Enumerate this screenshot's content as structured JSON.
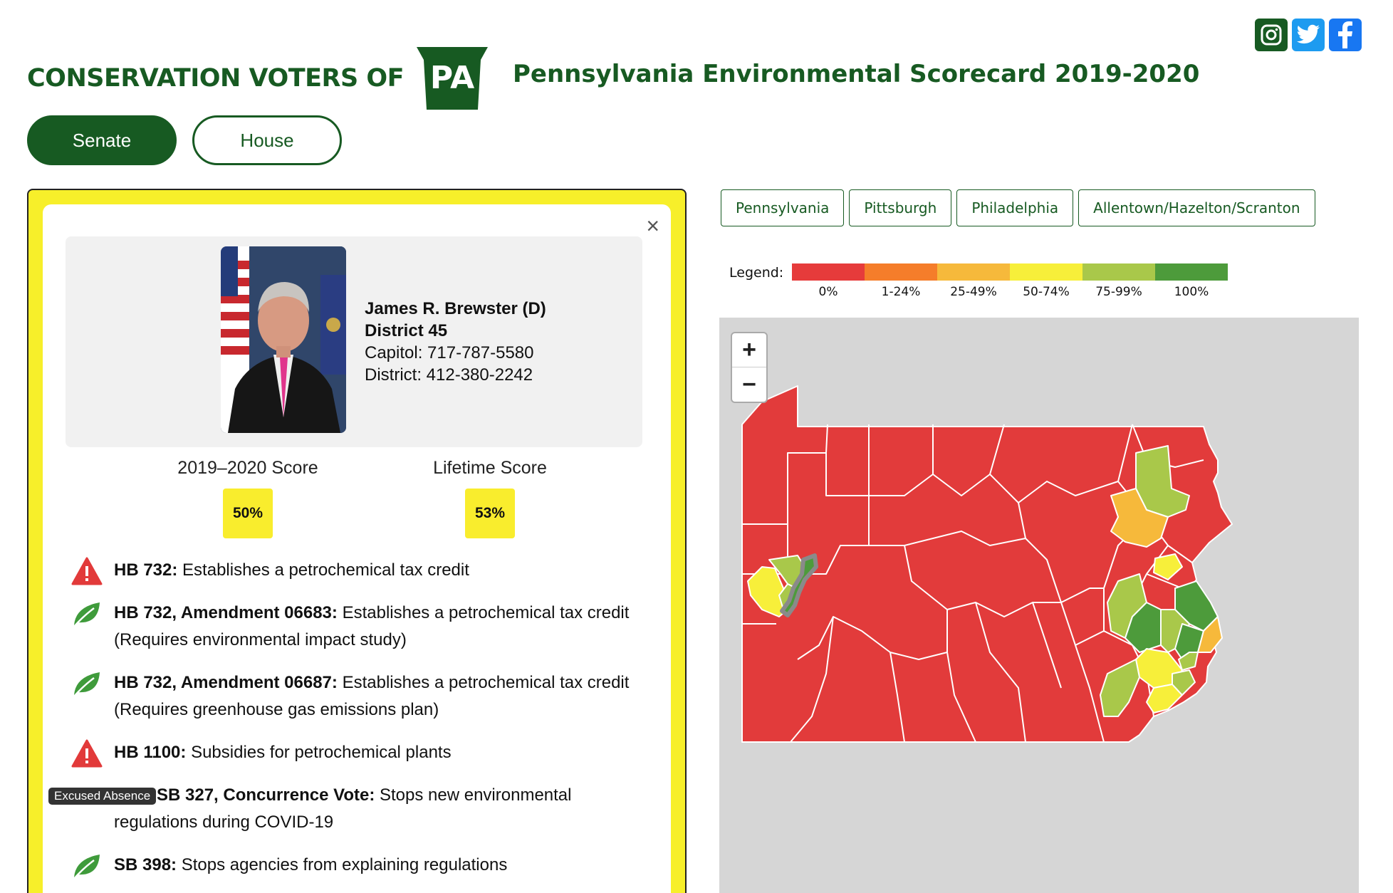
{
  "header": {
    "org_name": "CONSERVATION VOTERS OF",
    "logo_text": "PA",
    "title": "Pennsylvania Environmental Scorecard 2019-2020"
  },
  "social": [
    {
      "name": "instagram-icon",
      "color": "#175a22"
    },
    {
      "name": "twitter-icon",
      "color": "#1d9bf0"
    },
    {
      "name": "facebook-icon",
      "color": "#1877f2"
    }
  ],
  "chamber_tabs": {
    "senate": "Senate",
    "house": "House",
    "active": "Senate"
  },
  "legislator": {
    "name": "James R. Brewster (D)",
    "district": "District 45",
    "capitol_phone": "Capitol: 717-787-5580",
    "district_phone": "District: 412-380-2242",
    "close_label": "×"
  },
  "scores": {
    "current_label": "2019–2020 Score",
    "current_value": "50%",
    "lifetime_label": "Lifetime Score",
    "lifetime_value": "53%"
  },
  "votes": [
    {
      "icon": "warning-icon",
      "bill": "HB 732:",
      "desc": "Establishes a petrochemical tax credit"
    },
    {
      "icon": "leaf-icon",
      "bill": "HB 732, Amendment 06683:",
      "desc": "Establishes a petrochemical tax credit (Requires environmental impact study)"
    },
    {
      "icon": "leaf-icon",
      "bill": "HB 732, Amendment 06687:",
      "desc": "Establishes a petrochemical tax credit (Requires greenhouse gas emissions plan)"
    },
    {
      "icon": "warning-icon",
      "bill": "HB 1100:",
      "desc": "Subsidies for petrochemical plants"
    },
    {
      "icon": "excused-badge",
      "badge": "Excused Absence",
      "bill": "SB 327, Concurrence Vote:",
      "desc": "Stops new environmental",
      "desc2": "regulations during COVID-19"
    },
    {
      "icon": "leaf-icon",
      "bill": "SB 398:",
      "desc": "Stops agencies from explaining regulations"
    }
  ],
  "regions": [
    "Pennsylvania",
    "Pittsburgh",
    "Philadelphia",
    "Allentown/Hazelton/Scranton"
  ],
  "legend": {
    "label": "Legend:",
    "items": [
      {
        "label": "0%",
        "color": "#e63b3b"
      },
      {
        "label": "1-24%",
        "color": "#f57d2a"
      },
      {
        "label": "25-49%",
        "color": "#f6b93b"
      },
      {
        "label": "50-74%",
        "color": "#f7ef3a"
      },
      {
        "label": "75-99%",
        "color": "#a9c84a"
      },
      {
        "label": "100%",
        "color": "#4d9b3b"
      }
    ]
  },
  "map": {
    "zoom_in": "+",
    "zoom_out": "−"
  }
}
